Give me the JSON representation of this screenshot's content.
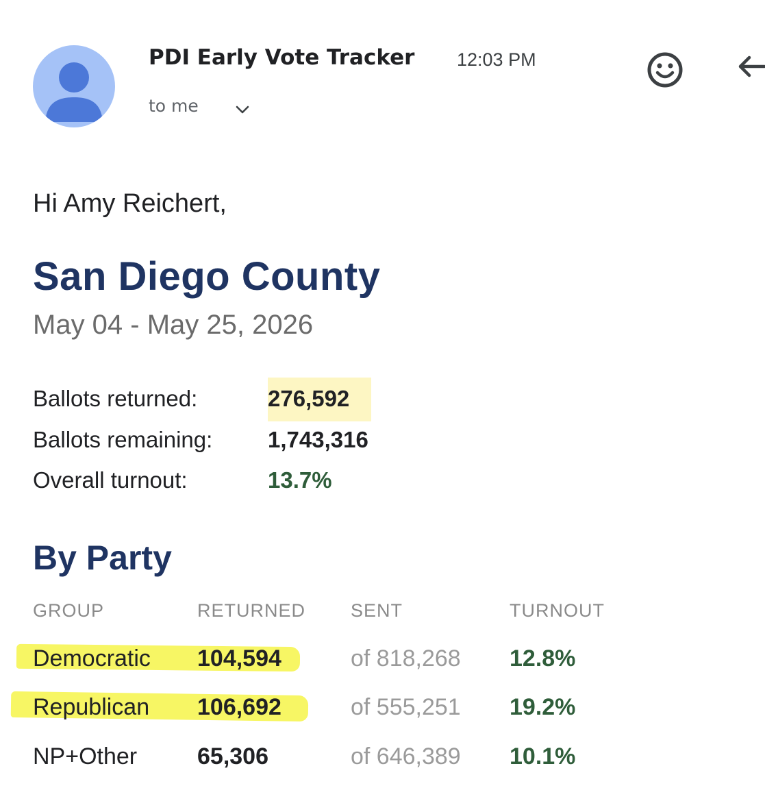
{
  "header": {
    "sender": "PDI Early Vote Tracker",
    "time": "12:03 PM",
    "recipient": "to me",
    "icons": {
      "avatar": "person-avatar-icon",
      "recipient_details": "chevron-down-icon",
      "reaction": "smiley-icon",
      "reply": "arrow-left-icon"
    },
    "avatar_color": "#a5c2f7",
    "avatar_figure_color": "#4c78d8"
  },
  "body": {
    "greeting": "Hi Amy Reichert,",
    "county": "San Diego County",
    "date_range": "May 04 - May 25, 2026",
    "stats": [
      {
        "label": "Ballots returned:",
        "value": "276,592"
      },
      {
        "label": "Ballots remaining:",
        "value": "1,743,316"
      },
      {
        "label": "Overall turnout:",
        "value": "13.7%"
      }
    ],
    "section_title": "By Party",
    "table": {
      "headers": [
        "GROUP",
        "RETURNED",
        "SENT",
        "TURNOUT"
      ],
      "rows": [
        {
          "group": "Democratic",
          "returned": "104,594",
          "sent": "of 818,268",
          "turnout": "12.8%"
        },
        {
          "group": "Republican",
          "returned": "106,692",
          "sent": "of 555,251",
          "turnout": "19.2%"
        },
        {
          "group": "NP+Other",
          "returned": "65,306",
          "sent": "of 646,389",
          "turnout": "10.1%"
        }
      ]
    }
  },
  "colors": {
    "title_navy": "#1f3462",
    "turnout_green": "#2f5d3a",
    "highlight_pale": "#fdf6c3",
    "marker_yellow": "#f6f553"
  }
}
